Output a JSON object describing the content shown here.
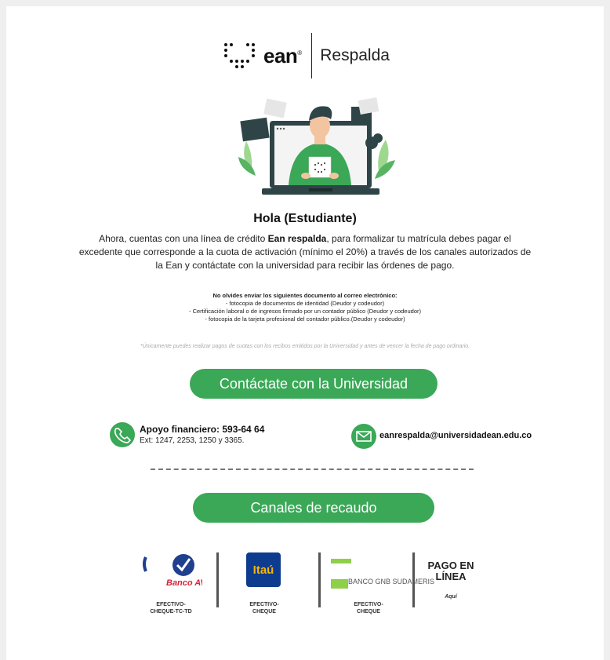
{
  "brand": {
    "name": "ean",
    "trademark": "®",
    "tagline": "Respalda"
  },
  "greeting": "Hola (Estudiante)",
  "intro": {
    "before_bold": "Ahora,  cuentas con una línea de crédito ",
    "bold": "Ean respalda",
    "after_bold": ", para formalizar tu matrícula debes pagar el excedente que corresponde a la cuota de activación (mínimo el 20%)  a través de los canales autorizados de la Ean y contáctate con la universidad para recibir las órdenes de pago."
  },
  "documents": {
    "heading": "No olvides enviar los siguientes documento al correo electrónico:",
    "items": [
      "- fotocopia de documentos de identidad (Deudor y codeudor)",
      "- Certificación laboral o de ingresos firmado por un contador público  (Deudor y codeudor)",
      "- fotocopia de la tarjeta profesional del contador público.(Deudor y codeudor)"
    ]
  },
  "note": "*Únicamente puedes realizar pagos de cuotas con los recibos emitidos por la Universidad y antes de  vencer la fecha de pago ordinario.",
  "contact_button": "Contáctate con la Universidad",
  "phone": {
    "title": "Apoyo financiero: 593-64 64",
    "ext": "Ext: 1247, 2253, 1250 y 3365."
  },
  "email": "eanrespalda@universidadean.edu.co",
  "channels_button": "Canales de recaudo",
  "banks": [
    {
      "logo_text": "Banco AV Villas",
      "caption": "EFECTIVO-\nCHEQUE-TC-TD"
    },
    {
      "logo_text": "Itaú",
      "caption": "EFECTIVO-\nCHEQUE"
    },
    {
      "logo_text": "BANCO GNB SUDAMERIS",
      "caption": "EFECTIVO-\nCHEQUE"
    },
    {
      "logo_text": "PAGO EN\nLÍNEA",
      "caption": "Aquí"
    }
  ],
  "colors": {
    "accent": "#3aa857",
    "bank_blue": "#1f3f8f",
    "bank_red": "#d6243a",
    "itau_blue": "#0d3b8e",
    "itau_yellow": "#f7b500"
  }
}
